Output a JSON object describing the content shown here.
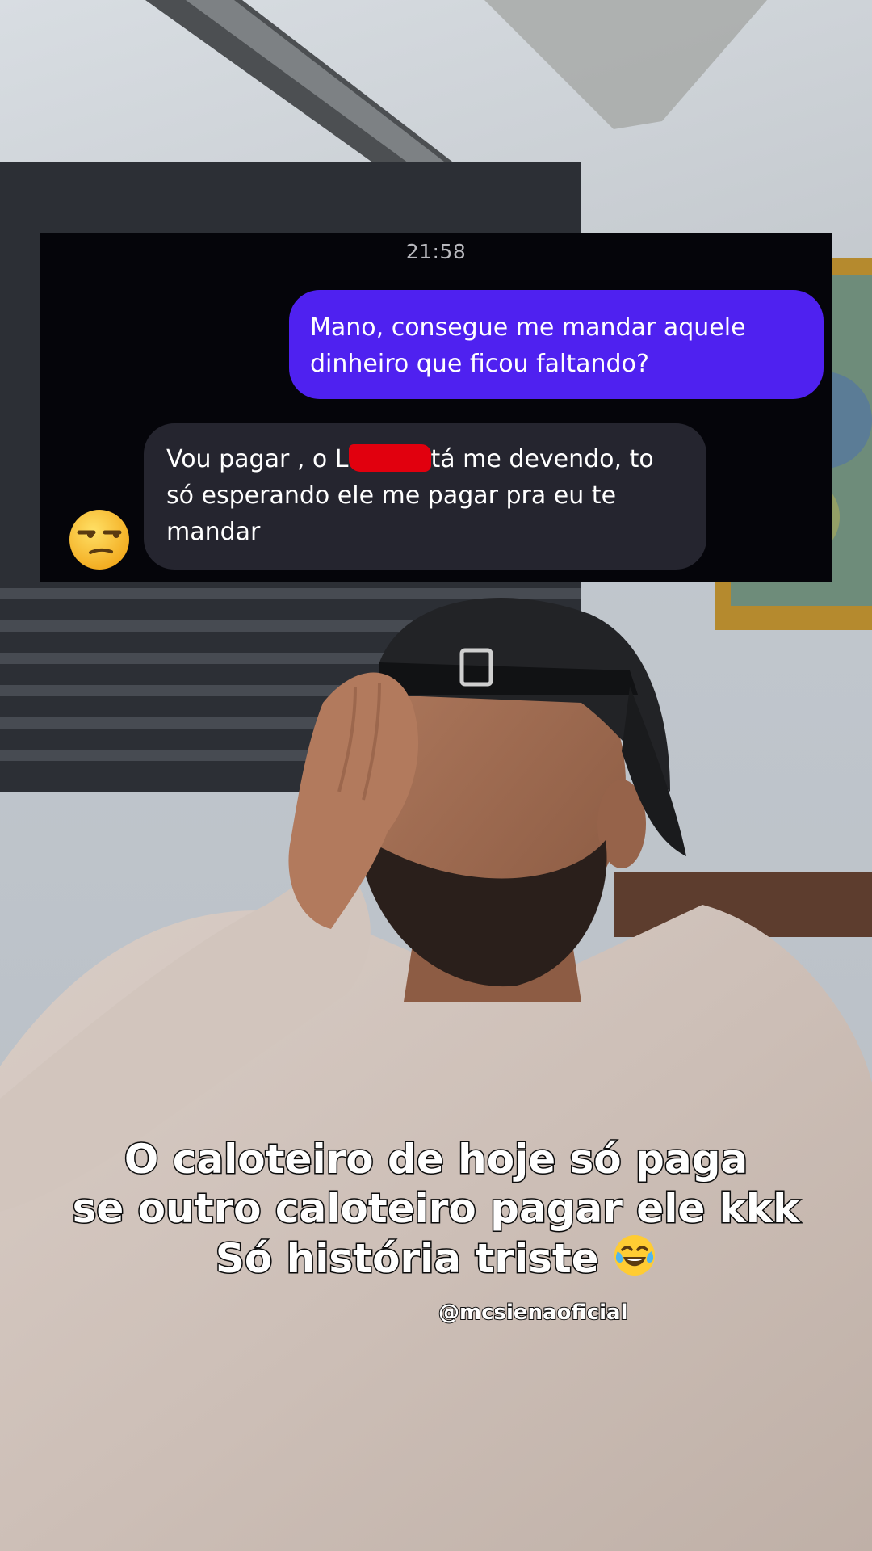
{
  "chat": {
    "time": "21:58",
    "sent_message": "Mano, consegue me mandar aquele dinheiro que ficou faltando?",
    "received_before_redaction": "Vou pagar , o L",
    "received_after_redaction": "tá me devendo, to só esperando ele me pagar pra eu te mandar",
    "reaction_icon": "unamused-face-icon",
    "colors": {
      "background": "#05050a",
      "sent_bubble": "#4f21f0",
      "received_bubble": "#25252f",
      "redaction": "#e1000e"
    }
  },
  "caption": {
    "line1": "O caloteiro de hoje só paga",
    "line2": "se outro caloteiro pagar ele kkk",
    "line3": "Só história triste",
    "line3_emoji": "face-with-tears-of-joy-icon",
    "handle": "@mcsienaoficial"
  }
}
